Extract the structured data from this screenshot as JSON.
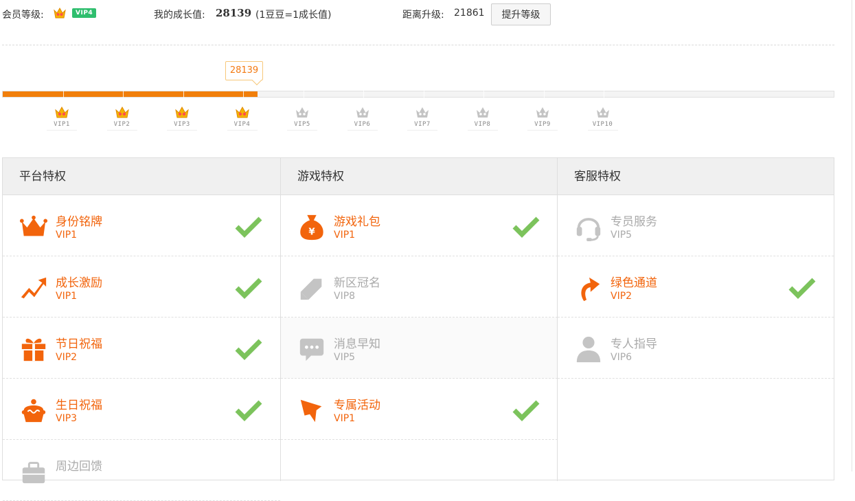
{
  "header": {
    "member_level_label": "会员等级:",
    "member_badge": "VIP4",
    "growth_label": "我的成长值:",
    "growth_value": "28139",
    "growth_note": "(1豆豆=1成长值)",
    "upgrade_gap_label": "距离升级:",
    "upgrade_gap_value": "21861",
    "upgrade_button": "提升等级"
  },
  "progress": {
    "current_value": "28139",
    "fraction": 0.307,
    "levels": [
      {
        "label": "VIP1",
        "reached": true
      },
      {
        "label": "VIP2",
        "reached": true
      },
      {
        "label": "VIP3",
        "reached": true
      },
      {
        "label": "VIP4",
        "reached": true
      },
      {
        "label": "VIP5",
        "reached": false
      },
      {
        "label": "VIP6",
        "reached": false
      },
      {
        "label": "VIP7",
        "reached": false
      },
      {
        "label": "VIP8",
        "reached": false
      },
      {
        "label": "VIP9",
        "reached": false
      },
      {
        "label": "VIP10",
        "reached": false
      }
    ]
  },
  "columns": [
    {
      "title": "平台特权",
      "items": [
        {
          "name": "身份铭牌",
          "level": "VIP1",
          "unlocked": true,
          "icon": "crown-icon"
        },
        {
          "name": "成长激励",
          "level": "VIP1",
          "unlocked": true,
          "icon": "trend-up-icon"
        },
        {
          "name": "节日祝福",
          "level": "VIP2",
          "unlocked": true,
          "icon": "gift-icon"
        },
        {
          "name": "生日祝福",
          "level": "VIP3",
          "unlocked": true,
          "icon": "cake-icon"
        },
        {
          "name": "周边回馈",
          "level": "",
          "unlocked": false,
          "icon": "briefcase-icon"
        }
      ]
    },
    {
      "title": "游戏特权",
      "items": [
        {
          "name": "游戏礼包",
          "level": "VIP1",
          "unlocked": true,
          "icon": "money-bag-icon"
        },
        {
          "name": "新区冠名",
          "level": "VIP8",
          "unlocked": false,
          "icon": "tag-icon"
        },
        {
          "name": "消息早知",
          "level": "VIP5",
          "unlocked": false,
          "icon": "chat-bubble-icon"
        },
        {
          "name": "专属活动",
          "level": "VIP1",
          "unlocked": true,
          "icon": "megaphone-icon"
        }
      ]
    },
    {
      "title": "客服特权",
      "items": [
        {
          "name": "专员服务",
          "level": "VIP5",
          "unlocked": false,
          "icon": "headset-icon"
        },
        {
          "name": "绿色通道",
          "level": "VIP2",
          "unlocked": true,
          "icon": "curved-arrow-icon"
        },
        {
          "name": "专人指导",
          "level": "VIP6",
          "unlocked": false,
          "icon": "person-icon"
        }
      ]
    }
  ],
  "colors": {
    "accent": "#f2640c",
    "progress": "#f17f0b",
    "check": "#7cc35c",
    "badge": "#2fbe6e",
    "disabled": "#aaaaaa"
  }
}
